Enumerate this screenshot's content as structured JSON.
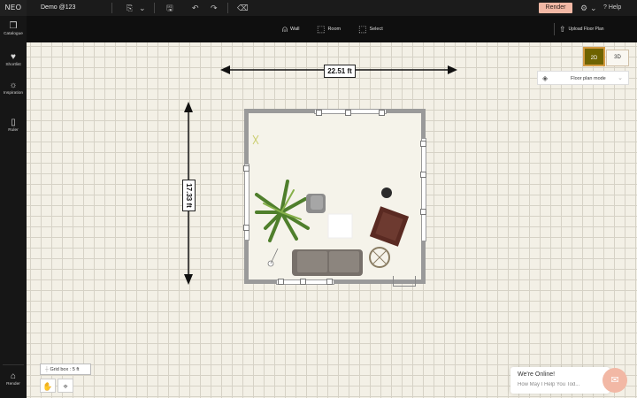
{
  "app": {
    "logo": "NEO",
    "project_name": "Demo @123"
  },
  "topbar": {
    "dropdown_icon": "chevron-down",
    "render_label": "Render",
    "help_label": "Help",
    "icons": [
      "layout-icon",
      "save-icon",
      "undo-icon",
      "redo-icon",
      "eraser-icon",
      "settings-icon",
      "help-icon"
    ]
  },
  "tools": {
    "wall": "Wall",
    "room": "Room",
    "select": "Select",
    "upload": "Upload Floor Plan"
  },
  "sidebar": {
    "items": [
      {
        "label": "Catalogue",
        "icon": "book-icon"
      },
      {
        "label": "Shortlist",
        "icon": "heart-icon"
      },
      {
        "label": "Inspiration",
        "icon": "bulb-icon"
      },
      {
        "label": "Ruler",
        "icon": "ruler-icon"
      },
      {
        "label": "Render",
        "icon": "render-icon"
      }
    ]
  },
  "canvas": {
    "width_label": "22.51 ft",
    "height_label": "17.33 ft",
    "grid_label": "Grid box : 5 ft"
  },
  "view": {
    "btn_2d": "2D",
    "btn_3d": "3D",
    "active": "2D",
    "mode_label": "Floor plan mode"
  },
  "chat": {
    "title": "We're Online!",
    "subtitle": "How May I Help You Tod..."
  },
  "colors": {
    "accent": "#f2b8a5",
    "active_view": "#6e6300",
    "topbar": "#1b1b1b"
  }
}
